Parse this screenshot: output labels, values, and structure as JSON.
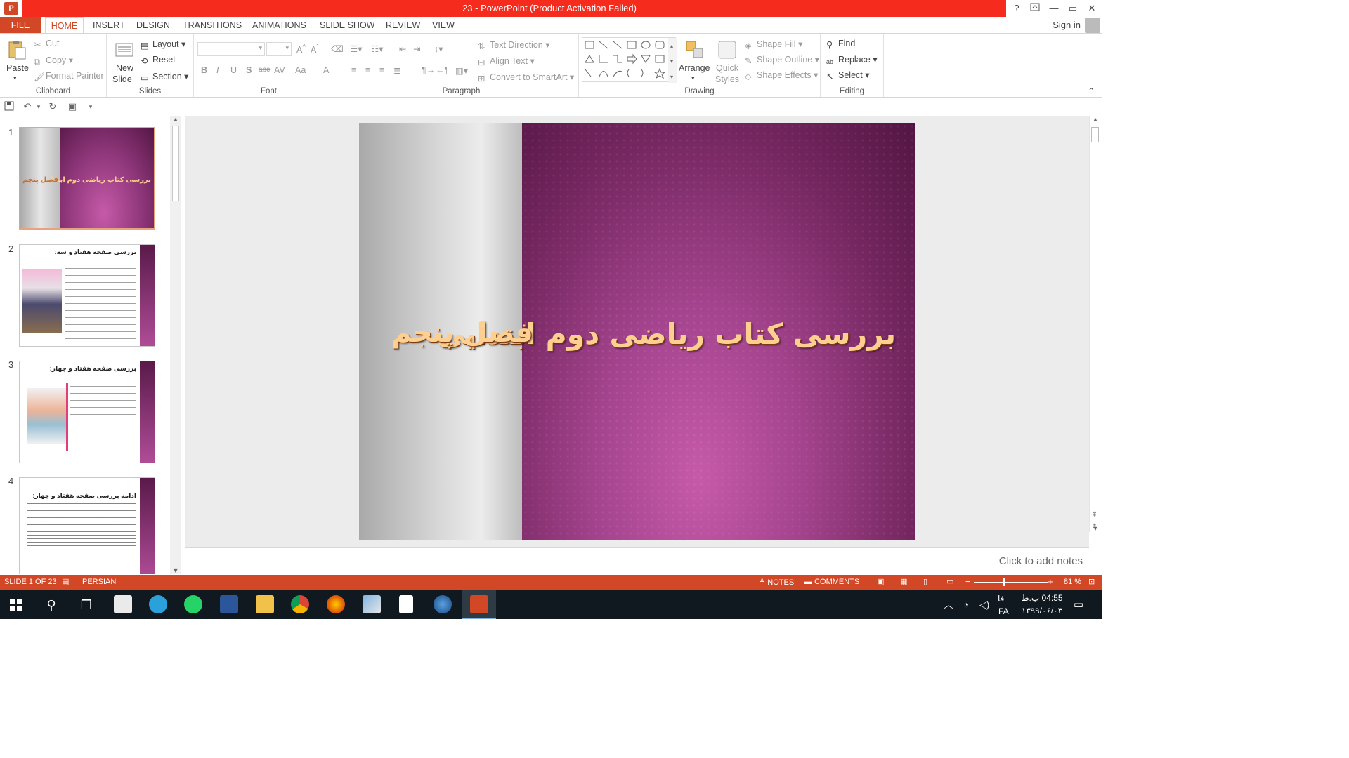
{
  "window": {
    "title": "23 -  PowerPoint (Product Activation Failed)",
    "help": "?",
    "minimize": "—",
    "restore": "▭",
    "close": "✕"
  },
  "tabs": [
    "FILE",
    "HOME",
    "INSERT",
    "DESIGN",
    "TRANSITIONS",
    "ANIMATIONS",
    "SLIDE SHOW",
    "REVIEW",
    "VIEW"
  ],
  "signin": "Sign in",
  "ribbon": {
    "clipboard": {
      "label": "Clipboard",
      "paste": "Paste",
      "cut": "Cut",
      "copy": "Copy",
      "format_painter": "Format Painter"
    },
    "slides": {
      "label": "Slides",
      "new_slide": "New",
      "new_slide_2": "Slide",
      "layout": "Layout",
      "reset": "Reset",
      "section": "Section"
    },
    "font": {
      "label": "Font",
      "bold": "B",
      "italic": "I",
      "underline": "U",
      "shadow": "S",
      "strike": "abc",
      "spacing": "AV",
      "case": "Aa",
      "color": "A"
    },
    "paragraph": {
      "label": "Paragraph",
      "text_direction": "Text Direction",
      "align_text": "Align Text",
      "smartart": "Convert to SmartArt"
    },
    "drawing": {
      "label": "Drawing",
      "arrange": "Arrange",
      "quick": "Quick",
      "styles": "Styles",
      "shape_fill": "Shape Fill",
      "shape_outline": "Shape Outline",
      "shape_effects": "Shape Effects"
    },
    "editing": {
      "label": "Editing",
      "find": "Find",
      "replace": "Replace",
      "select": "Select"
    }
  },
  "thumbnails": [
    {
      "num": "1",
      "title": "بررسی کتاب ریاضی دوم ابتدایی",
      "subtitle": "فصل پنجم"
    },
    {
      "num": "2",
      "title": "بررسی صفحه هفتاد و سه:"
    },
    {
      "num": "3",
      "title": "بررسی صفحه هفتاد و چهار:"
    },
    {
      "num": "4",
      "title": "ادامه بررسی صفحه هفتاد و چهار:"
    }
  ],
  "slide": {
    "title": "بررسی کتاب ریاضی دوم ابتدایی",
    "subtitle": "فصل پنجم"
  },
  "notes_placeholder": "Click to add notes",
  "status": {
    "slide_count": "SLIDE 1 OF 23",
    "language": "PERSIAN",
    "notes": "NOTES",
    "comments": "COMMENTS",
    "zoom": "81 %",
    "zoom_minus": "−",
    "zoom_plus": "+",
    "zoom_level": 0.81
  },
  "taskbar": {
    "time": "04:55 ب.ظ",
    "date": "۱۳۹۹/۰۶/۰۳",
    "lang1": "فا",
    "lang2": "FA"
  },
  "colors": {
    "accent": "#d24726",
    "title_red": "#f52b1d",
    "slide_text": "#ffcf8f"
  }
}
